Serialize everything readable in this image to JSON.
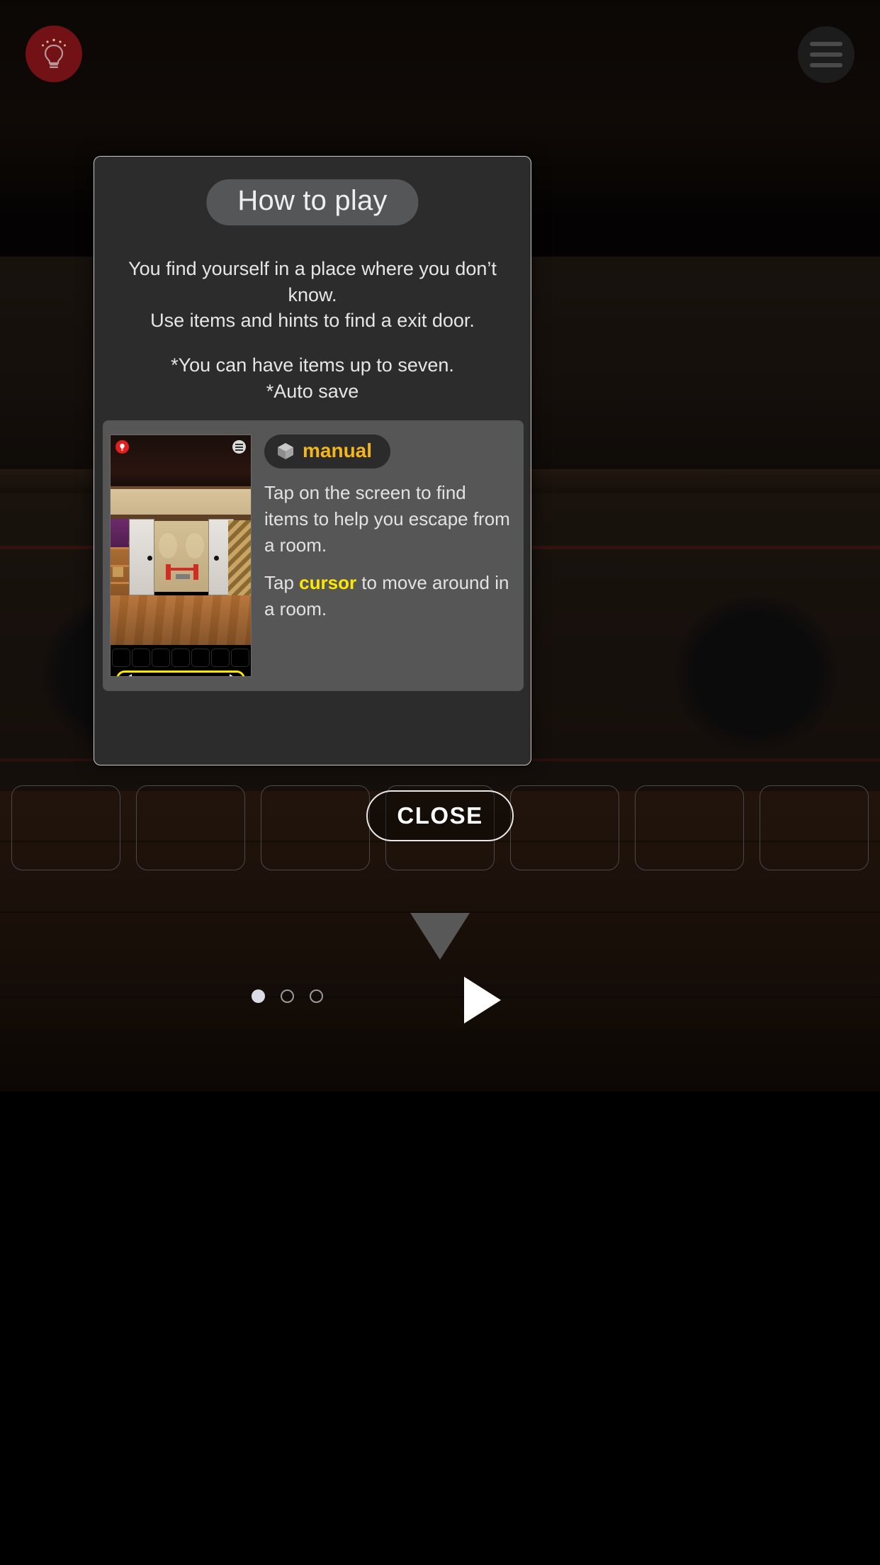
{
  "topbar": {
    "hint_button": {
      "icon": "lightbulb-icon",
      "color": "#7b1218"
    },
    "menu_button": {
      "icon": "hamburger-menu-icon",
      "color": "#1c1c1c"
    }
  },
  "modal": {
    "title": "How to play",
    "intro_line1": "You find yourself in a place where you don’t know.",
    "intro_line2": "Use items and hints to find a exit door.",
    "intro_line3": "*You can have items up to seven.",
    "intro_line4": "*Auto save",
    "card": {
      "badge_label": "manual",
      "badge_icon": "cube-icon",
      "badge_text_color": "#f5b61b",
      "paragraph1": "Tap on the screen to find items to help you escape from a room.",
      "paragraph2_pre": "Tap ",
      "paragraph2_highlight": "cursor",
      "paragraph2_post": " to move around in a room.",
      "highlight_color": "#ffe800",
      "thumbnail": {
        "name": "game-room-screenshot",
        "hint_icon": "lightbulb-icon",
        "menu_icon": "hamburger-menu-icon",
        "cursor_bar_color": "#ffe800",
        "left_arrow": "◀",
        "right_arrow": "▶",
        "item_slot_count": 7
      }
    },
    "pagination": {
      "total": 3,
      "active_index": 0
    },
    "next_button": {
      "icon": "play-triangle-icon"
    }
  },
  "bottombar": {
    "item_slot_count": 7,
    "close_label": "CLOSE",
    "down_arrow_icon": "triangle-down-icon"
  }
}
